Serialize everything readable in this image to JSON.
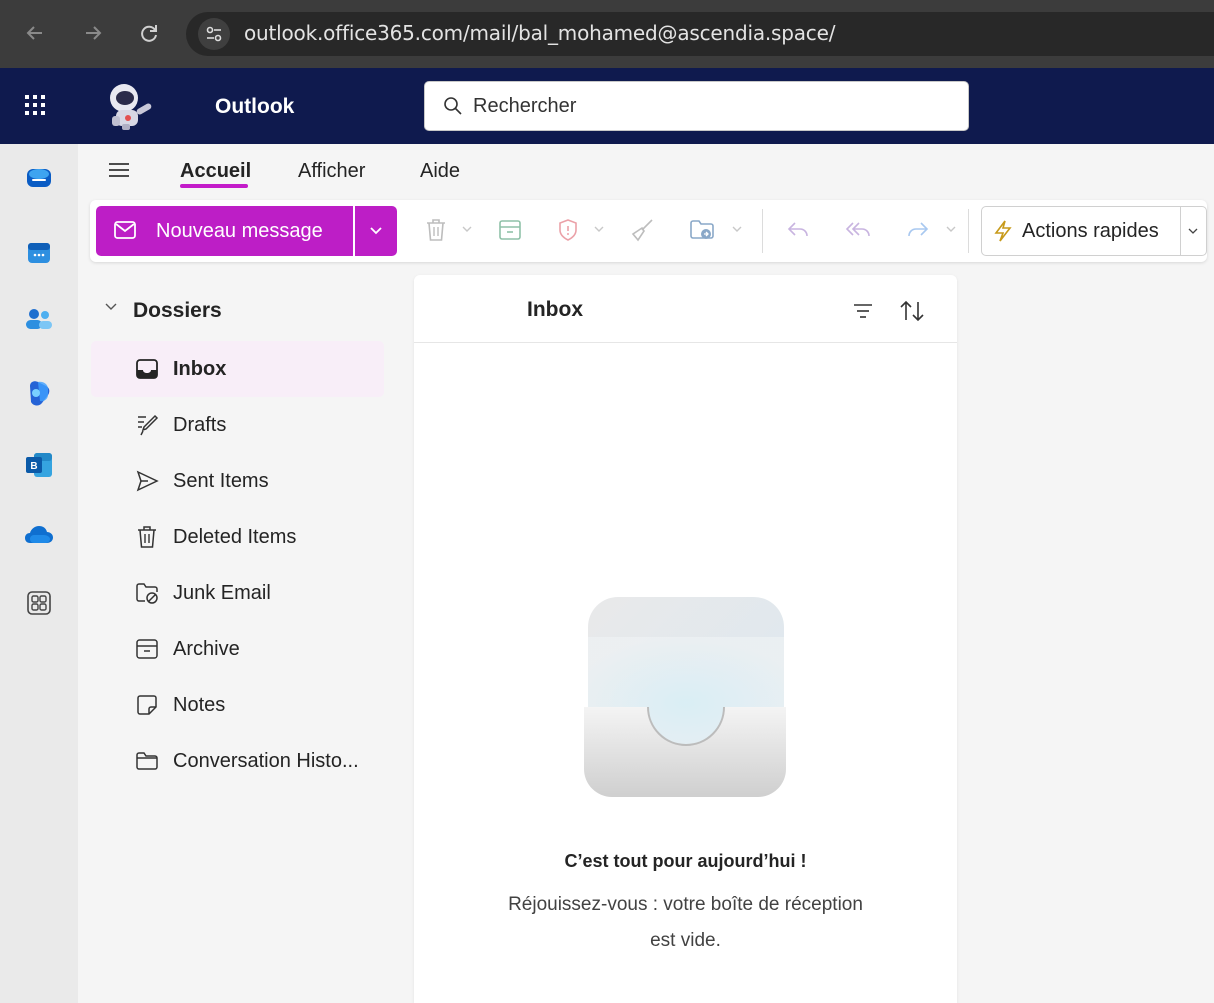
{
  "browser": {
    "url": "outlook.office365.com/mail/bal_mohamed@ascendia.space/",
    "icons": [
      "back-arrow-icon",
      "forward-arrow-icon",
      "reload-icon",
      "site-settings-icon"
    ]
  },
  "header": {
    "app_title": "Outlook",
    "search_placeholder": "Rechercher"
  },
  "ribbon": {
    "tabs": [
      {
        "label": "Accueil",
        "active": true
      },
      {
        "label": "Afficher",
        "active": false
      },
      {
        "label": "Aide",
        "active": false
      }
    ],
    "new_message_label": "Nouveau message",
    "quick_actions_label": "Actions rapides"
  },
  "folders": {
    "title": "Dossiers",
    "items": [
      {
        "label": "Inbox",
        "icon": "inbox-icon",
        "active": true
      },
      {
        "label": "Drafts",
        "icon": "drafts-icon",
        "active": false
      },
      {
        "label": "Sent Items",
        "icon": "send-icon",
        "active": false
      },
      {
        "label": "Deleted Items",
        "icon": "trash-icon",
        "active": false
      },
      {
        "label": "Junk Email",
        "icon": "junk-folder-icon",
        "active": false
      },
      {
        "label": "Archive",
        "icon": "archive-icon",
        "active": false
      },
      {
        "label": "Notes",
        "icon": "note-icon",
        "active": false
      },
      {
        "label": "Conversation Histo...",
        "icon": "folder-icon",
        "active": false
      }
    ]
  },
  "message_list": {
    "title": "Inbox",
    "empty_title": "C’est tout pour aujourd’hui !",
    "empty_line1": "Réjouissez-vous : votre boîte de réception",
    "empty_line2": "est vide."
  },
  "colors": {
    "header_bg": "#0f1a4e",
    "accent": "#bd1ec6",
    "browser_bg": "#3c3c3c"
  }
}
